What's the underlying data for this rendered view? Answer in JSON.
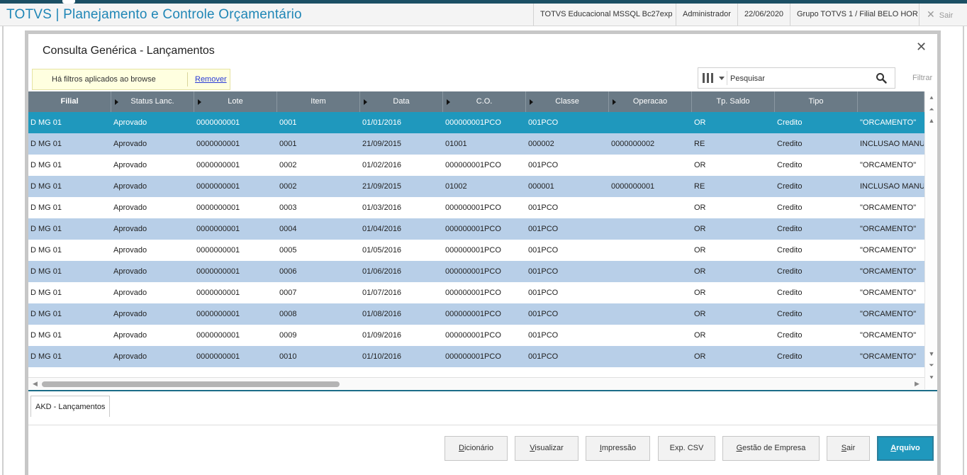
{
  "app": {
    "title": "TOTVS | Planejamento e Controle Orçamentário",
    "environment": "TOTVS Educacional MSSQL Bc27exp",
    "user": "Administrador",
    "date": "22/06/2020",
    "group": "Grupo TOTVS 1 / Filial BELO HOR",
    "exit_label": "Sair"
  },
  "dialog": {
    "title": "Consulta Genérica - Lançamentos",
    "close_icon": "close-icon"
  },
  "filter_notice": {
    "text": "Há filtros aplicados ao browse",
    "remove_label": "Remover"
  },
  "search": {
    "placeholder": "Pesquisar",
    "filter_label": "Filtrar"
  },
  "grid": {
    "columns": [
      "Filial",
      "Status Lanc.",
      "Lote",
      "Item",
      "Data",
      "C.O.",
      "Classe",
      "Operacao",
      "Tp. Saldo",
      "Tipo",
      ""
    ],
    "rows": [
      [
        "D MG 01",
        "Aprovado",
        "0000000001",
        "0001",
        "01/01/2016",
        "000000001PCO",
        "001PCO",
        "",
        "OR",
        "Credito",
        "\"ORCAMENTO\""
      ],
      [
        "D MG 01",
        "Aprovado",
        "0000000001",
        "0001",
        "21/09/2015",
        "01001",
        "000002",
        "0000000002",
        "RE",
        "Credito",
        "INCLUSAO MANUA"
      ],
      [
        "D MG 01",
        "Aprovado",
        "0000000001",
        "0002",
        "01/02/2016",
        "000000001PCO",
        "001PCO",
        "",
        "OR",
        "Credito",
        "\"ORCAMENTO\""
      ],
      [
        "D MG 01",
        "Aprovado",
        "0000000001",
        "0002",
        "21/09/2015",
        "01002",
        "000001",
        "0000000001",
        "RE",
        "Credito",
        "INCLUSAO MANUA"
      ],
      [
        "D MG 01",
        "Aprovado",
        "0000000001",
        "0003",
        "01/03/2016",
        "000000001PCO",
        "001PCO",
        "",
        "OR",
        "Credito",
        "\"ORCAMENTO\""
      ],
      [
        "D MG 01",
        "Aprovado",
        "0000000001",
        "0004",
        "01/04/2016",
        "000000001PCO",
        "001PCO",
        "",
        "OR",
        "Credito",
        "\"ORCAMENTO\""
      ],
      [
        "D MG 01",
        "Aprovado",
        "0000000001",
        "0005",
        "01/05/2016",
        "000000001PCO",
        "001PCO",
        "",
        "OR",
        "Credito",
        "\"ORCAMENTO\""
      ],
      [
        "D MG 01",
        "Aprovado",
        "0000000001",
        "0006",
        "01/06/2016",
        "000000001PCO",
        "001PCO",
        "",
        "OR",
        "Credito",
        "\"ORCAMENTO\""
      ],
      [
        "D MG 01",
        "Aprovado",
        "0000000001",
        "0007",
        "01/07/2016",
        "000000001PCO",
        "001PCO",
        "",
        "OR",
        "Credito",
        "\"ORCAMENTO\""
      ],
      [
        "D MG 01",
        "Aprovado",
        "0000000001",
        "0008",
        "01/08/2016",
        "000000001PCO",
        "001PCO",
        "",
        "OR",
        "Credito",
        "\"ORCAMENTO\""
      ],
      [
        "D MG 01",
        "Aprovado",
        "0000000001",
        "0009",
        "01/09/2016",
        "000000001PCO",
        "001PCO",
        "",
        "OR",
        "Credito",
        "\"ORCAMENTO\""
      ],
      [
        "D MG 01",
        "Aprovado",
        "0000000001",
        "0010",
        "01/10/2016",
        "000000001PCO",
        "001PCO",
        "",
        "OR",
        "Credito",
        "\"ORCAMENTO\""
      ]
    ],
    "selected_row": 0
  },
  "tabs": [
    {
      "label": "AKD - Lançamentos"
    }
  ],
  "buttons": [
    {
      "label": "Dicionário",
      "underline": "D",
      "rest": "icionário"
    },
    {
      "label": "Visualizar",
      "underline": "V",
      "rest": "isualizar"
    },
    {
      "label": "Impressão",
      "underline": "I",
      "rest": "mpressão"
    },
    {
      "label": "Exp. CSV",
      "underline": "",
      "rest": "Exp. CSV"
    },
    {
      "label": "Gestão de Empresa",
      "underline": "G",
      "rest": "estão de Empresa"
    },
    {
      "label": "Sair",
      "underline": "S",
      "rest": "air"
    },
    {
      "label": "Arquivo",
      "underline": "A",
      "rest": "rquivo"
    }
  ],
  "colors": {
    "accent": "#1f98bd",
    "title": "#1f86b6",
    "header_bg": "#6a7a86",
    "row_alt": "#b8cfe8",
    "filter_bg": "#ffffe0"
  }
}
